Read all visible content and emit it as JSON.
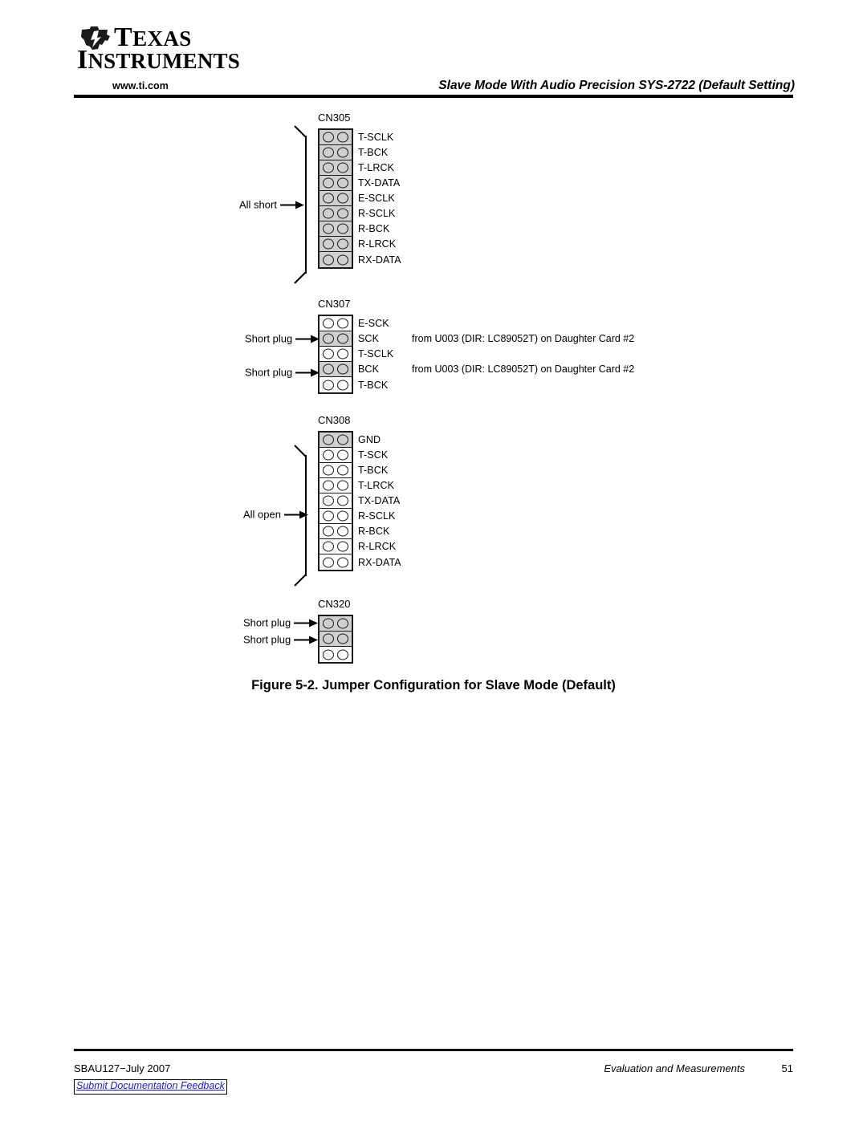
{
  "brand": {
    "name_line1": "TEXAS",
    "name_line2": "INSTRUMENTS",
    "url": "www.ti.com",
    "logo_icon": "ti-texas-state-logo"
  },
  "header": {
    "title": "Slave Mode With Audio Precision SYS-2722 (Default Setting)"
  },
  "figure": {
    "caption": "Figure 5-2. Jumper Configuration for Slave Mode (Default)",
    "blocks": [
      {
        "id": "CN305",
        "title": "CN305",
        "rows": [
          {
            "label": "T-SCLK",
            "shorted": true
          },
          {
            "label": "T-BCK",
            "shorted": true
          },
          {
            "label": "T-LRCK",
            "shorted": true
          },
          {
            "label": "TX-DATA",
            "shorted": true
          },
          {
            "label": "E-SCLK",
            "shorted": true
          },
          {
            "label": "R-SCLK",
            "shorted": true
          },
          {
            "label": "R-BCK",
            "shorted": true
          },
          {
            "label": "R-LRCK",
            "shorted": true
          },
          {
            "label": "RX-DATA",
            "shorted": true
          }
        ],
        "bracket_annotation": "All short"
      },
      {
        "id": "CN307",
        "title": "CN307",
        "rows": [
          {
            "label": "E-SCK",
            "shorted": false,
            "annotation": "",
            "note": ""
          },
          {
            "label": "SCK",
            "shorted": true,
            "annotation": "Short plug",
            "note": "from U003 (DIR: LC89052T) on Daughter Card #2"
          },
          {
            "label": "T-SCLK",
            "shorted": false,
            "annotation": "",
            "note": ""
          },
          {
            "label": "BCK",
            "shorted": true,
            "annotation": "Short plug",
            "note": "from U003 (DIR: LC89052T) on Daughter Card #2"
          },
          {
            "label": "T-BCK",
            "shorted": false,
            "annotation": "",
            "note": ""
          }
        ]
      },
      {
        "id": "CN308",
        "title": "CN308",
        "rows": [
          {
            "label": "GND",
            "shorted": true
          },
          {
            "label": "T-SCK",
            "shorted": false
          },
          {
            "label": "T-BCK",
            "shorted": false
          },
          {
            "label": "T-LRCK",
            "shorted": false
          },
          {
            "label": "TX-DATA",
            "shorted": false
          },
          {
            "label": "R-SCLK",
            "shorted": false
          },
          {
            "label": "R-BCK",
            "shorted": false
          },
          {
            "label": "R-LRCK",
            "shorted": false
          },
          {
            "label": "RX-DATA",
            "shorted": false
          }
        ],
        "bracket_annotation": "All open"
      },
      {
        "id": "CN320",
        "title": "CN320",
        "rows": [
          {
            "label": "",
            "shorted": true,
            "annotation": "Short plug"
          },
          {
            "label": "",
            "shorted": true,
            "annotation": "Short plug"
          },
          {
            "label": "",
            "shorted": false,
            "annotation": ""
          }
        ]
      }
    ]
  },
  "footer": {
    "document_id": "SBAU127−July 2007",
    "section": "Evaluation and Measurements",
    "page_number": "51",
    "feedback_link": "Submit Documentation Feedback"
  }
}
